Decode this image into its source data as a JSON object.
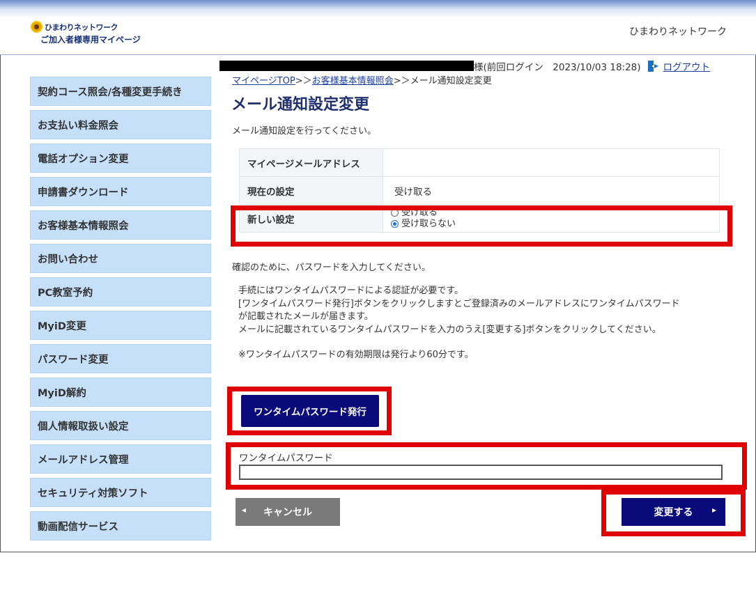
{
  "header": {
    "brand": "ひまわりネットワーク",
    "sub": "ご加入者様専用マイページ",
    "site_name": "ひまわりネットワーク"
  },
  "sidebar": {
    "items": [
      {
        "label": "契約コース照会/各種変更手続き"
      },
      {
        "label": "お支払い料金照会"
      },
      {
        "label": "電話オプション変更"
      },
      {
        "label": "申請書ダウンロード"
      },
      {
        "label": "お客様基本情報照会"
      },
      {
        "label": "お問い合わせ"
      },
      {
        "label": "PC教室予約"
      },
      {
        "label": "MyiD変更"
      },
      {
        "label": "パスワード変更"
      },
      {
        "label": "MyiD解約"
      },
      {
        "label": "個人情報取扱い設定"
      },
      {
        "label": "メールアドレス管理"
      },
      {
        "label": "セキュリティ対策ソフト"
      },
      {
        "label": "動画配信サービス"
      }
    ]
  },
  "userline": {
    "tail": "様(前回ログイン　2023/10/03 18:28)",
    "logout": "ログアウト"
  },
  "breadcrumb": {
    "top": "マイページTOP",
    "sep1": ">＞",
    "customer": "お客様基本情報照会",
    "sep2": ">＞",
    "current": "メール通知設定変更"
  },
  "page": {
    "title": "メール通知設定変更",
    "intro": "メール通知設定を行ってください。"
  },
  "settings": {
    "address_label": "マイページメールアドレス",
    "address_value": "",
    "current_label": "現在の設定",
    "current_value": "受け取る",
    "new_label": "新しい設定",
    "options": [
      "受け取る",
      "受け取らない"
    ],
    "selected_index": 1
  },
  "confirm_text": "確認のために、パスワードを入力してください。",
  "notes": {
    "line1": "手続にはワンタイムパスワードによる認証が必要です。",
    "line2": "[ワンタイムパスワード発行]ボタンをクリックしますとご登録済みのメールアドレスにワンタイムパスワード",
    "line3": "が記載されたメールが届きます。",
    "line4": "メールに記載されているワンタイムパスワードを入力のうえ[変更する]ボタンをクリックしてください。",
    "line5": "※ワンタイムパスワードの有効期限は発行より60分です。"
  },
  "otp": {
    "button_label": "ワンタイムパスワード発行",
    "field_label": "ワンタイムパスワード",
    "value": ""
  },
  "actions": {
    "cancel": "キャンセル",
    "submit": "変更する"
  },
  "colors": {
    "nav_bg": "#c5e0f8",
    "primary_button": "#0a0a7a",
    "cancel_button": "#7a7a7a",
    "highlight": "#e00000",
    "title": "#1f2f6e"
  }
}
